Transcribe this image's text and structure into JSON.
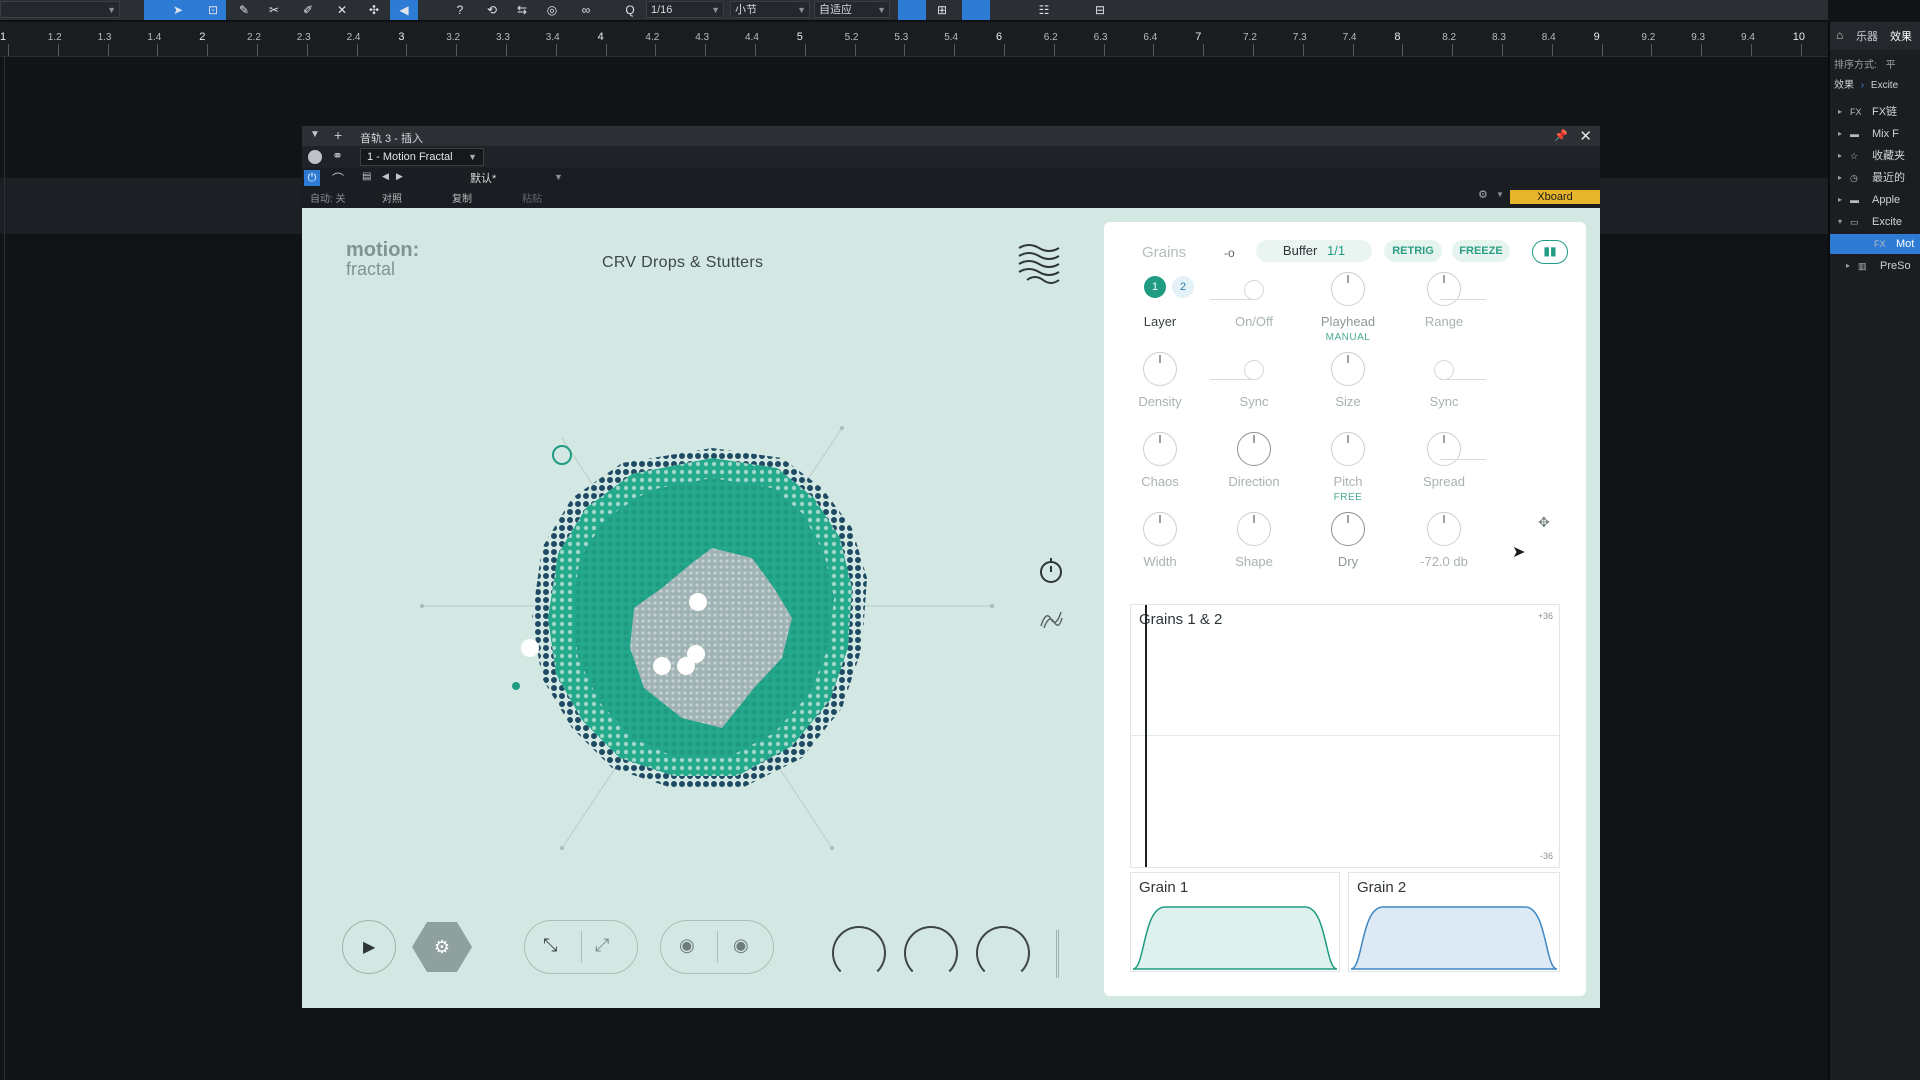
{
  "toolbar": {
    "quantize": "1/16",
    "timebase": "小节",
    "snap": "自适应"
  },
  "ruler": {
    "labels": [
      "1",
      "1.2",
      "1.3",
      "1.4",
      "2",
      "2.2",
      "2.3",
      "2.4",
      "3",
      "3.2",
      "3.3",
      "3.4",
      "4",
      "4.2",
      "4.3",
      "4.4",
      "5",
      "5.2",
      "5.3",
      "5.4",
      "6",
      "6.2",
      "6.3",
      "6.4",
      "7",
      "7.2",
      "7.3",
      "7.4",
      "8",
      "8.2",
      "8.3",
      "8.4",
      "9",
      "9.2",
      "9.3",
      "9.4",
      "10"
    ]
  },
  "browser": {
    "tabs": [
      "乐器",
      "效果"
    ],
    "sort_label": "排序方式:",
    "sort_value": "平",
    "crumb_root": "效果",
    "crumb_sub": "Excite",
    "items": [
      {
        "label": "FX链",
        "icon": "fx-chain-icon"
      },
      {
        "label": "Mix F",
        "icon": "folder-icon"
      },
      {
        "label": "收藏夹",
        "icon": "star-icon"
      },
      {
        "label": "最近的",
        "icon": "clock-icon"
      },
      {
        "label": "Apple",
        "icon": "folder-icon"
      },
      {
        "label": "Excite",
        "icon": "folder-open-icon"
      },
      {
        "label": "Mot",
        "icon": "fx-icon"
      },
      {
        "label": "PreSo",
        "icon": "piano-icon"
      }
    ]
  },
  "plugin_window": {
    "title": "音轨 3 - 插入",
    "device": "1 - Motion Fractal",
    "preset": "默认*",
    "auto_label": "自动: 关",
    "compare_label": "对照",
    "copy_label": "复制",
    "paste_label": "粘贴",
    "xboard_label": "Xboard"
  },
  "plugin": {
    "logo_line1": "motion:",
    "logo_line2": "fractal",
    "preset_name": "CRV Drops & Stutters",
    "grains_title": "Grains",
    "buffer_label": "Buffer",
    "buffer_value": "1/1",
    "retrig_label": "RETRIG",
    "freeze_label": "FREEZE",
    "layers": [
      "1",
      "2"
    ],
    "knobs": [
      {
        "label": "Layer",
        "sub": ""
      },
      {
        "label": "On/Off",
        "sub": ""
      },
      {
        "label": "Playhead",
        "sub": "MANUAL"
      },
      {
        "label": "Range",
        "sub": ""
      },
      {
        "label": "Density",
        "sub": ""
      },
      {
        "label": "Sync",
        "sub": ""
      },
      {
        "label": "Size",
        "sub": ""
      },
      {
        "label": "Sync",
        "sub": ""
      },
      {
        "label": "Chaos",
        "sub": ""
      },
      {
        "label": "Direction",
        "sub": ""
      },
      {
        "label": "Pitch",
        "sub": "FREE"
      },
      {
        "label": "Spread",
        "sub": ""
      },
      {
        "label": "Width",
        "sub": ""
      },
      {
        "label": "Shape",
        "sub": ""
      },
      {
        "label": "Dry",
        "sub": ""
      },
      {
        "label": "-72.0 db",
        "sub": ""
      }
    ],
    "scope_title": "Grains 1 & 2",
    "scope_top": "+36",
    "scope_bottom": "-36",
    "grain1_title": "Grain 1",
    "grain2_title": "Grain 2",
    "colors": {
      "accent": "#1f9c82",
      "dark": "#1e4a63",
      "bg": "#d3e8e3"
    }
  }
}
